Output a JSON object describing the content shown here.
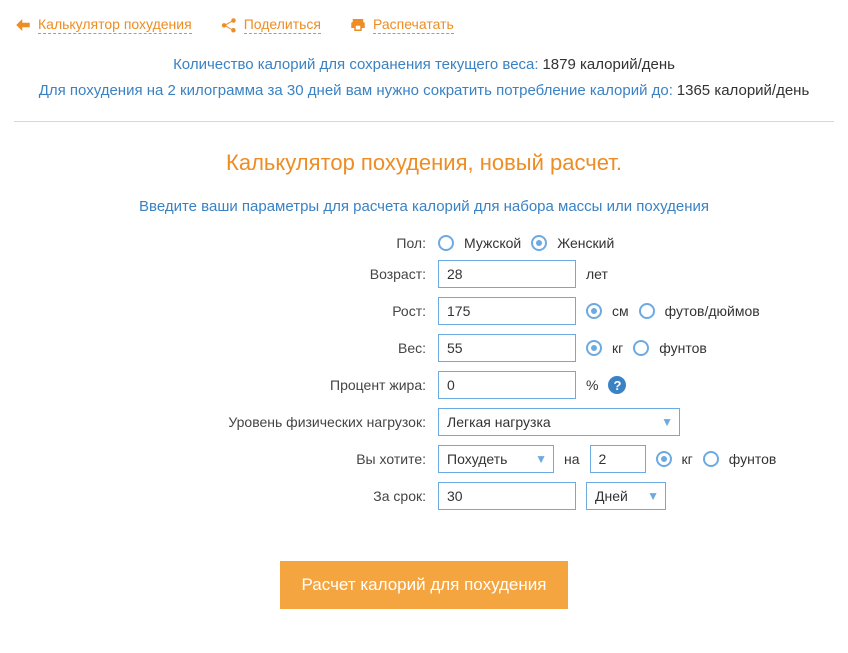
{
  "top": {
    "back": "Калькулятор похудения",
    "share": "Поделиться",
    "print": "Распечатать"
  },
  "result": {
    "line1_label": "Количество калорий для сохранения текущего веса:",
    "line1_value": "1879 калорий/день",
    "line2_label": "Для похудения на 2 килограмма за 30 дней вам нужно сократить потребление калорий до:",
    "line2_value": "1365 калорий/день"
  },
  "title": "Калькулятор похудения, новый расчет.",
  "subtitle": "Введите ваши параметры для расчета калорий для набора массы или похудения",
  "form": {
    "gender_label": "Пол:",
    "gender_male": "Мужской",
    "gender_female": "Женский",
    "age_label": "Возраст:",
    "age_value": "28",
    "age_unit": "лет",
    "height_label": "Рост:",
    "height_value": "175",
    "height_cm": "см",
    "height_ft": "футов/дюймов",
    "weight_label": "Вес:",
    "weight_value": "55",
    "weight_kg": "кг",
    "weight_lb": "фунтов",
    "fat_label": "Процент жира:",
    "fat_value": "0",
    "fat_unit": "%",
    "activity_label": "Уровень физических нагрузок:",
    "activity_value": "Легкая нагрузка",
    "goal_label": "Вы хотите:",
    "goal_value": "Похудеть",
    "goal_sep": "на",
    "goal_amount": "2",
    "goal_kg": "кг",
    "goal_lb": "фунтов",
    "period_label": "За срок:",
    "period_value": "30",
    "period_unit": "Дней",
    "submit": "Расчет калорий для похудения"
  }
}
